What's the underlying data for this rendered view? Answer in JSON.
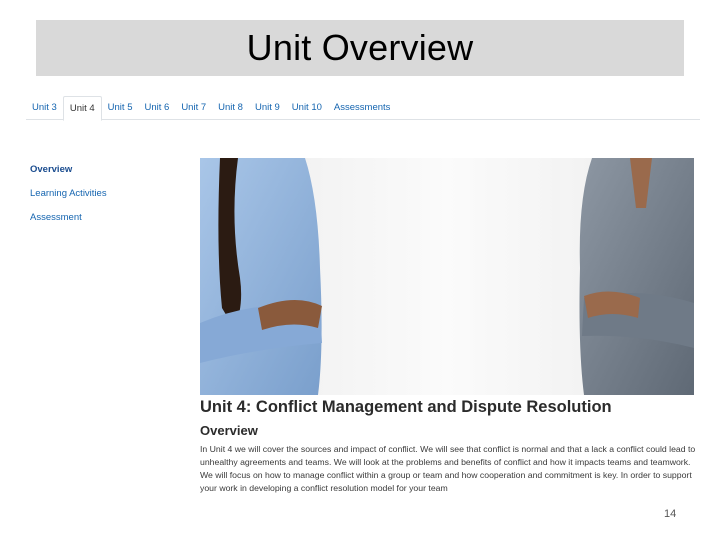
{
  "slide": {
    "title": "Unit Overview",
    "page_number": "14"
  },
  "tabs": [
    {
      "label": "Unit 3",
      "active": false
    },
    {
      "label": "Unit 4",
      "active": true
    },
    {
      "label": "Unit 5",
      "active": false
    },
    {
      "label": "Unit 6",
      "active": false
    },
    {
      "label": "Unit 7",
      "active": false
    },
    {
      "label": "Unit 8",
      "active": false
    },
    {
      "label": "Unit 9",
      "active": false
    },
    {
      "label": "Unit 10",
      "active": false
    },
    {
      "label": "Assessments",
      "active": false
    }
  ],
  "sidebar": {
    "items": [
      {
        "label": "Overview",
        "active": true
      },
      {
        "label": "Learning Activities",
        "active": false
      },
      {
        "label": "Assessment",
        "active": false
      }
    ]
  },
  "hero": {
    "icon": "two-people-arms-crossed-photo"
  },
  "main": {
    "heading": "Unit 4: Conflict Management and Dispute Resolution",
    "subheading": "Overview",
    "body": "In Unit 4 we will cover the sources and impact of conflict. We will see that conflict is normal and that a lack a conflict could lead to unhealthy agreements and teams. We will look at the problems and benefits of conflict and how it impacts teams and teamwork. We will focus on how to manage conflict within a group or team and how cooperation and commitment is key. In order to support your work in developing a conflict resolution model for your team"
  },
  "colors": {
    "link": "#1565b0",
    "title_bar_bg": "#d9d9d9",
    "shirt_left": "#8fb3de",
    "shirt_right": "#7b8694"
  }
}
